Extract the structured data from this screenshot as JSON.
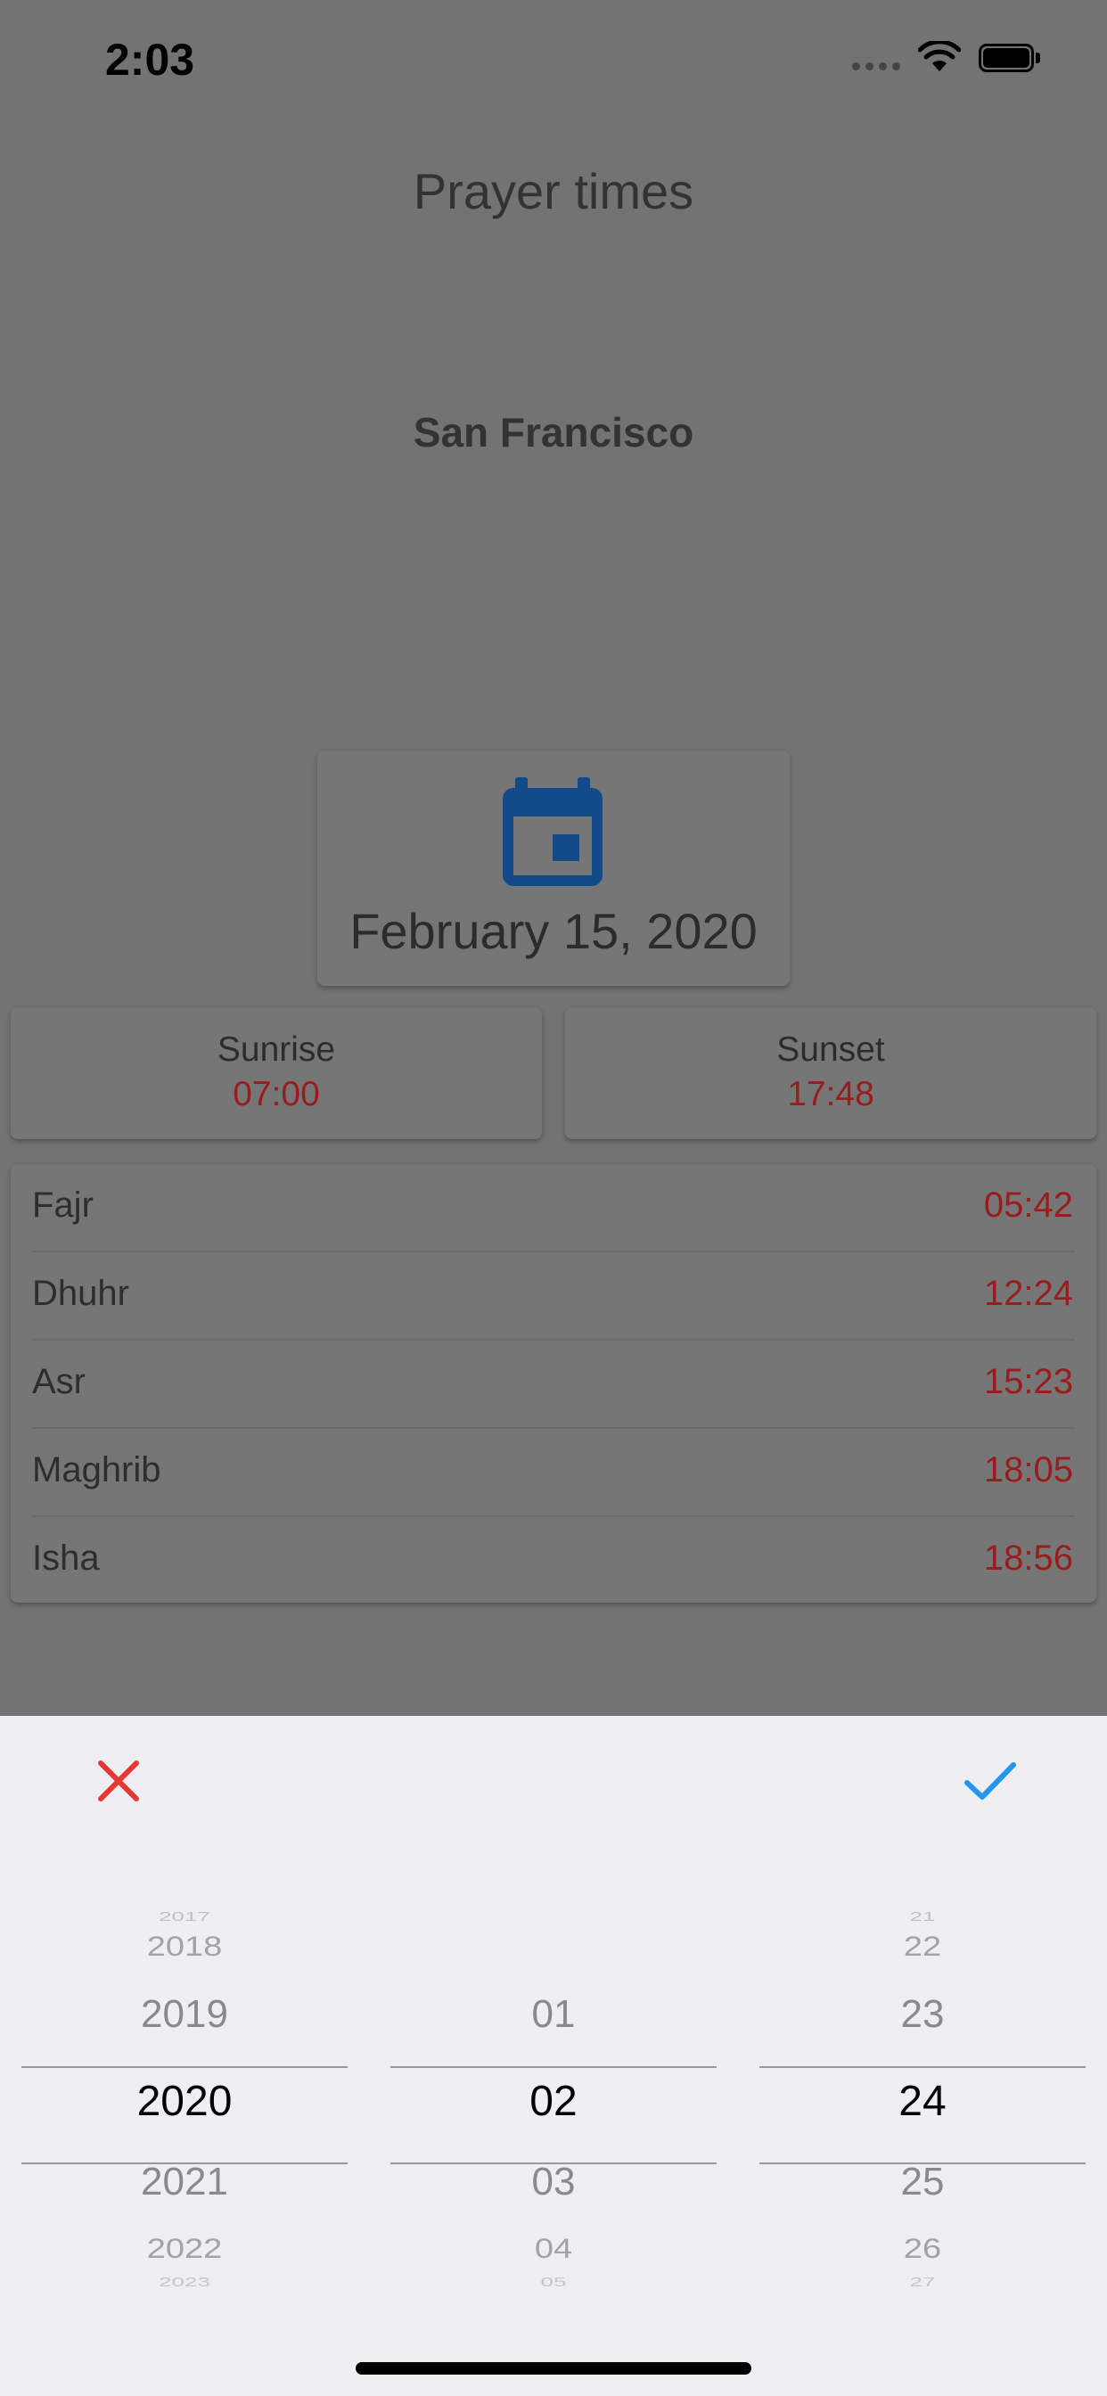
{
  "status_bar": {
    "time": "2:03"
  },
  "header": {
    "title": "Prayer times"
  },
  "location": {
    "city": "San Francisco"
  },
  "date_card": {
    "date": "February 15, 2020",
    "icon": "calendar-icon"
  },
  "sun": {
    "sunrise_label": "Sunrise",
    "sunrise_time": "07:00",
    "sunset_label": "Sunset",
    "sunset_time": "17:48"
  },
  "prayers": [
    {
      "name": "Fajr",
      "time": "05:42"
    },
    {
      "name": "Dhuhr",
      "time": "12:24"
    },
    {
      "name": "Asr",
      "time": "15:23"
    },
    {
      "name": "Maghrib",
      "time": "18:05"
    },
    {
      "name": "Isha",
      "time": "18:56"
    }
  ],
  "picker": {
    "cancel_icon": "close-icon",
    "confirm_icon": "checkmark-icon",
    "year": {
      "items": [
        "2017",
        "2018",
        "2019",
        "2020",
        "2021",
        "2022",
        "2023"
      ],
      "selected": "2020"
    },
    "month": {
      "items": [
        "01",
        "02",
        "03",
        "04",
        "05"
      ],
      "selected": "02"
    },
    "day": {
      "items": [
        "21",
        "22",
        "23",
        "24",
        "25",
        "26",
        "27"
      ],
      "selected": "24"
    }
  },
  "colors": {
    "overlay": "#737373",
    "time_red": "#9a1d1d",
    "calendar_blue": "#134a8a",
    "cancel_red": "#e53935",
    "confirm_blue": "#2196f3",
    "sheet_bg": "#efeef2"
  }
}
